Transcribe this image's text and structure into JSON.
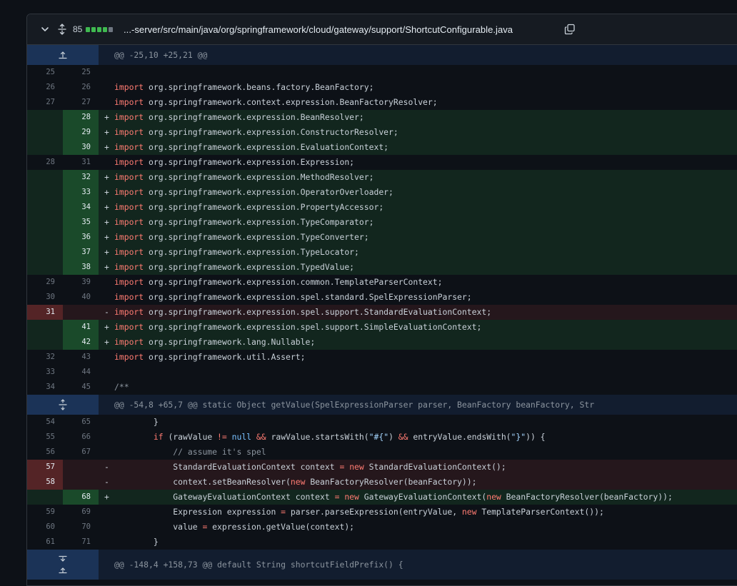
{
  "file": {
    "changes": "85",
    "diffstat": [
      "added",
      "added",
      "added",
      "added",
      "neutral"
    ],
    "path": "...-server/src/main/java/org/springframework/cloud/gateway/support/ShortcutConfigurable.java"
  },
  "hunks": [
    {
      "header": "@@ -25,10 +25,21 @@"
    },
    {
      "header": "@@ -54,8 +65,7 @@ static Object getValue(SpelExpressionParser parser, BeanFactory beanFactory, Str"
    },
    {
      "header": "@@ -148,4 +158,73 @@ default String shortcutFieldPrefix() {"
    }
  ],
  "lines": [
    {
      "type": "ctx",
      "old": "25",
      "new": "25",
      "marker": " ",
      "tokens": []
    },
    {
      "type": "ctx",
      "old": "26",
      "new": "26",
      "marker": " ",
      "tokens": [
        {
          "k": "kw",
          "t": "import"
        },
        {
          "k": "",
          "t": " org.springframework.beans.factory.BeanFactory;"
        }
      ]
    },
    {
      "type": "ctx",
      "old": "27",
      "new": "27",
      "marker": " ",
      "tokens": [
        {
          "k": "kw",
          "t": "import"
        },
        {
          "k": "",
          "t": " org.springframework.context.expression.BeanFactoryResolver;"
        }
      ]
    },
    {
      "type": "add",
      "old": "",
      "new": "28",
      "marker": "+",
      "tokens": [
        {
          "k": "kw",
          "t": "import"
        },
        {
          "k": "",
          "t": " org.springframework.expression.BeanResolver;"
        }
      ]
    },
    {
      "type": "add",
      "old": "",
      "new": "29",
      "marker": "+",
      "tokens": [
        {
          "k": "kw",
          "t": "import"
        },
        {
          "k": "",
          "t": " org.springframework.expression.ConstructorResolver;"
        }
      ]
    },
    {
      "type": "add",
      "old": "",
      "new": "30",
      "marker": "+",
      "tokens": [
        {
          "k": "kw",
          "t": "import"
        },
        {
          "k": "",
          "t": " org.springframework.expression.EvaluationContext;"
        }
      ]
    },
    {
      "type": "ctx",
      "old": "28",
      "new": "31",
      "marker": " ",
      "tokens": [
        {
          "k": "kw",
          "t": "import"
        },
        {
          "k": "",
          "t": " org.springframework.expression.Expression;"
        }
      ]
    },
    {
      "type": "add",
      "old": "",
      "new": "32",
      "marker": "+",
      "tokens": [
        {
          "k": "kw",
          "t": "import"
        },
        {
          "k": "",
          "t": " org.springframework.expression.MethodResolver;"
        }
      ]
    },
    {
      "type": "add",
      "old": "",
      "new": "33",
      "marker": "+",
      "tokens": [
        {
          "k": "kw",
          "t": "import"
        },
        {
          "k": "",
          "t": " org.springframework.expression.OperatorOverloader;"
        }
      ]
    },
    {
      "type": "add",
      "old": "",
      "new": "34",
      "marker": "+",
      "tokens": [
        {
          "k": "kw",
          "t": "import"
        },
        {
          "k": "",
          "t": " org.springframework.expression.PropertyAccessor;"
        }
      ]
    },
    {
      "type": "add",
      "old": "",
      "new": "35",
      "marker": "+",
      "tokens": [
        {
          "k": "kw",
          "t": "import"
        },
        {
          "k": "",
          "t": " org.springframework.expression.TypeComparator;"
        }
      ]
    },
    {
      "type": "add",
      "old": "",
      "new": "36",
      "marker": "+",
      "tokens": [
        {
          "k": "kw",
          "t": "import"
        },
        {
          "k": "",
          "t": " org.springframework.expression.TypeConverter;"
        }
      ]
    },
    {
      "type": "add",
      "old": "",
      "new": "37",
      "marker": "+",
      "tokens": [
        {
          "k": "kw",
          "t": "import"
        },
        {
          "k": "",
          "t": " org.springframework.expression.TypeLocator;"
        }
      ]
    },
    {
      "type": "add",
      "old": "",
      "new": "38",
      "marker": "+",
      "tokens": [
        {
          "k": "kw",
          "t": "import"
        },
        {
          "k": "",
          "t": " org.springframework.expression.TypedValue;"
        }
      ]
    },
    {
      "type": "ctx",
      "old": "29",
      "new": "39",
      "marker": " ",
      "tokens": [
        {
          "k": "kw",
          "t": "import"
        },
        {
          "k": "",
          "t": " org.springframework.expression.common.TemplateParserContext;"
        }
      ]
    },
    {
      "type": "ctx",
      "old": "30",
      "new": "40",
      "marker": " ",
      "tokens": [
        {
          "k": "kw",
          "t": "import"
        },
        {
          "k": "",
          "t": " org.springframework.expression.spel.standard.SpelExpressionParser;"
        }
      ]
    },
    {
      "type": "del",
      "old": "31",
      "new": "",
      "marker": "-",
      "tokens": [
        {
          "k": "kw",
          "t": "import"
        },
        {
          "k": "",
          "t": " org.springframework.expression.spel.support.StandardEvaluationContext;"
        }
      ]
    },
    {
      "type": "add",
      "old": "",
      "new": "41",
      "marker": "+",
      "tokens": [
        {
          "k": "kw",
          "t": "import"
        },
        {
          "k": "",
          "t": " org.springframework.expression.spel.support.SimpleEvaluationContext;"
        }
      ]
    },
    {
      "type": "add",
      "old": "",
      "new": "42",
      "marker": "+",
      "tokens": [
        {
          "k": "kw",
          "t": "import"
        },
        {
          "k": "",
          "t": " org.springframework.lang.Nullable;"
        }
      ]
    },
    {
      "type": "ctx",
      "old": "32",
      "new": "43",
      "marker": " ",
      "tokens": [
        {
          "k": "kw",
          "t": "import"
        },
        {
          "k": "",
          "t": " org.springframework.util.Assert;"
        }
      ]
    },
    {
      "type": "ctx",
      "old": "33",
      "new": "44",
      "marker": " ",
      "tokens": []
    },
    {
      "type": "ctx",
      "old": "34",
      "new": "45",
      "marker": " ",
      "tokens": [
        {
          "k": "cmt",
          "t": "/**"
        }
      ]
    },
    {
      "type": "hunk",
      "hunk": 1
    },
    {
      "type": "ctx",
      "old": "54",
      "new": "65",
      "marker": " ",
      "tokens": [
        {
          "k": "",
          "t": "        }"
        }
      ]
    },
    {
      "type": "ctx",
      "old": "55",
      "new": "66",
      "marker": " ",
      "tokens": [
        {
          "k": "",
          "t": "        "
        },
        {
          "k": "kw",
          "t": "if"
        },
        {
          "k": "",
          "t": " (rawValue "
        },
        {
          "k": "kw",
          "t": "!="
        },
        {
          "k": "",
          "t": " "
        },
        {
          "k": "kwb",
          "t": "null"
        },
        {
          "k": "",
          "t": " "
        },
        {
          "k": "kw",
          "t": "&&"
        },
        {
          "k": "",
          "t": " rawValue.startsWith("
        },
        {
          "k": "str",
          "t": "\"#{\""
        },
        {
          "k": "",
          "t": ") "
        },
        {
          "k": "kw",
          "t": "&&"
        },
        {
          "k": "",
          "t": " entryValue.endsWith("
        },
        {
          "k": "str",
          "t": "\"}\""
        },
        {
          "k": "",
          "t": ")) {"
        }
      ]
    },
    {
      "type": "ctx",
      "old": "56",
      "new": "67",
      "marker": " ",
      "tokens": [
        {
          "k": "cmt",
          "t": "            // assume it's spel"
        }
      ]
    },
    {
      "type": "del",
      "old": "57",
      "new": "",
      "marker": "-",
      "tokens": [
        {
          "k": "",
          "t": "            StandardEvaluationContext context "
        },
        {
          "k": "kw",
          "t": "="
        },
        {
          "k": "",
          "t": " "
        },
        {
          "k": "kw",
          "t": "new"
        },
        {
          "k": "",
          "t": " StandardEvaluationContext();"
        }
      ]
    },
    {
      "type": "del",
      "old": "58",
      "new": "",
      "marker": "-",
      "tokens": [
        {
          "k": "",
          "t": "            context.setBeanResolver("
        },
        {
          "k": "kw",
          "t": "new"
        },
        {
          "k": "",
          "t": " BeanFactoryResolver(beanFactory));"
        }
      ]
    },
    {
      "type": "add",
      "old": "",
      "new": "68",
      "marker": "+",
      "tokens": [
        {
          "k": "",
          "t": "            GatewayEvaluationContext context "
        },
        {
          "k": "kw",
          "t": "="
        },
        {
          "k": "",
          "t": " "
        },
        {
          "k": "kw",
          "t": "new"
        },
        {
          "k": "",
          "t": " GatewayEvaluationContext("
        },
        {
          "k": "kw",
          "t": "new"
        },
        {
          "k": "",
          "t": " BeanFactoryResolver(beanFactory));"
        }
      ]
    },
    {
      "type": "ctx",
      "old": "59",
      "new": "69",
      "marker": " ",
      "tokens": [
        {
          "k": "",
          "t": "            Expression expression "
        },
        {
          "k": "kw",
          "t": "="
        },
        {
          "k": "",
          "t": " parser.parseExpression(entryValue, "
        },
        {
          "k": "kw",
          "t": "new"
        },
        {
          "k": "",
          "t": " TemplateParserContext());"
        }
      ]
    },
    {
      "type": "ctx",
      "old": "60",
      "new": "70",
      "marker": " ",
      "tokens": [
        {
          "k": "",
          "t": "            value "
        },
        {
          "k": "kw",
          "t": "="
        },
        {
          "k": "",
          "t": " expression.getValue(context);"
        }
      ]
    },
    {
      "type": "ctx",
      "old": "61",
      "new": "71",
      "marker": " ",
      "tokens": [
        {
          "k": "",
          "t": "        }"
        }
      ]
    },
    {
      "type": "hunk",
      "hunk": 2
    }
  ],
  "colors": {
    "add_bg": "#12261e",
    "del_bg": "#25171c",
    "keyword": "#ff7b72",
    "string": "#a5d6ff"
  }
}
